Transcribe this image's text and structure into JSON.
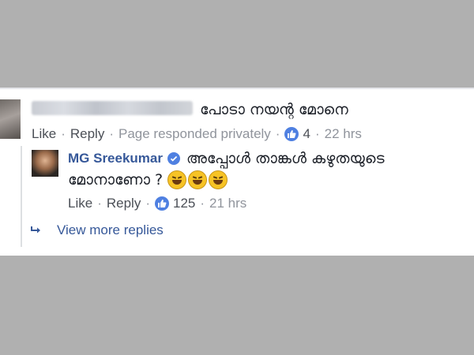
{
  "comment1": {
    "text": "പോടാ നയന്റ മോനെ",
    "like_label": "Like",
    "reply_label": "Reply",
    "status": "Page responded privately",
    "like_count": "4",
    "time": "22 hrs"
  },
  "reply": {
    "author": "MG Sreekumar",
    "text_line1": "അപ്പോൾ താങ്കൾ കഴുതയുടെ",
    "text_line2": "മോനാണോ ?",
    "emoji_icon": "rolling-on-floor-laughing-emoji",
    "like_label": "Like",
    "reply_label": "Reply",
    "like_count": "125",
    "time": "21 hrs"
  },
  "view_more": {
    "label": "View more replies",
    "icon": "reply-arrow-icon"
  },
  "colors": {
    "link": "#365899",
    "meta": "#90949c",
    "like_blue": "#4f80e1",
    "background": "#b0b0b0"
  }
}
